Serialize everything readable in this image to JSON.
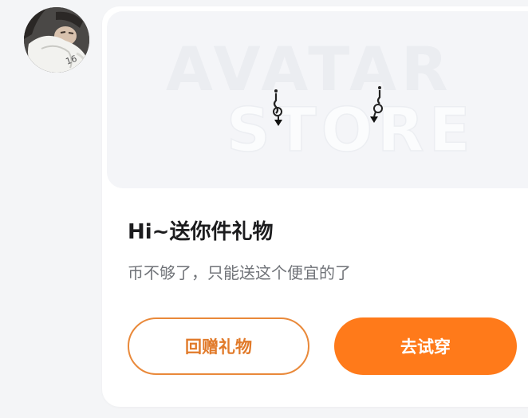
{
  "preview": {
    "watermark_line1": "AVATAR",
    "watermark_line2": "STORE"
  },
  "gift_card": {
    "title": "Hi~送你件礼物",
    "subtitle": "币不够了，只能送这个便宜的了"
  },
  "buttons": {
    "return_gift_label": "回赠礼物",
    "try_on_label": "去试穿"
  },
  "colors": {
    "accent_orange": "#ff7a1a",
    "outline_orange": "#e9893a"
  },
  "icons": {
    "gift_item": "earrings-icon"
  }
}
